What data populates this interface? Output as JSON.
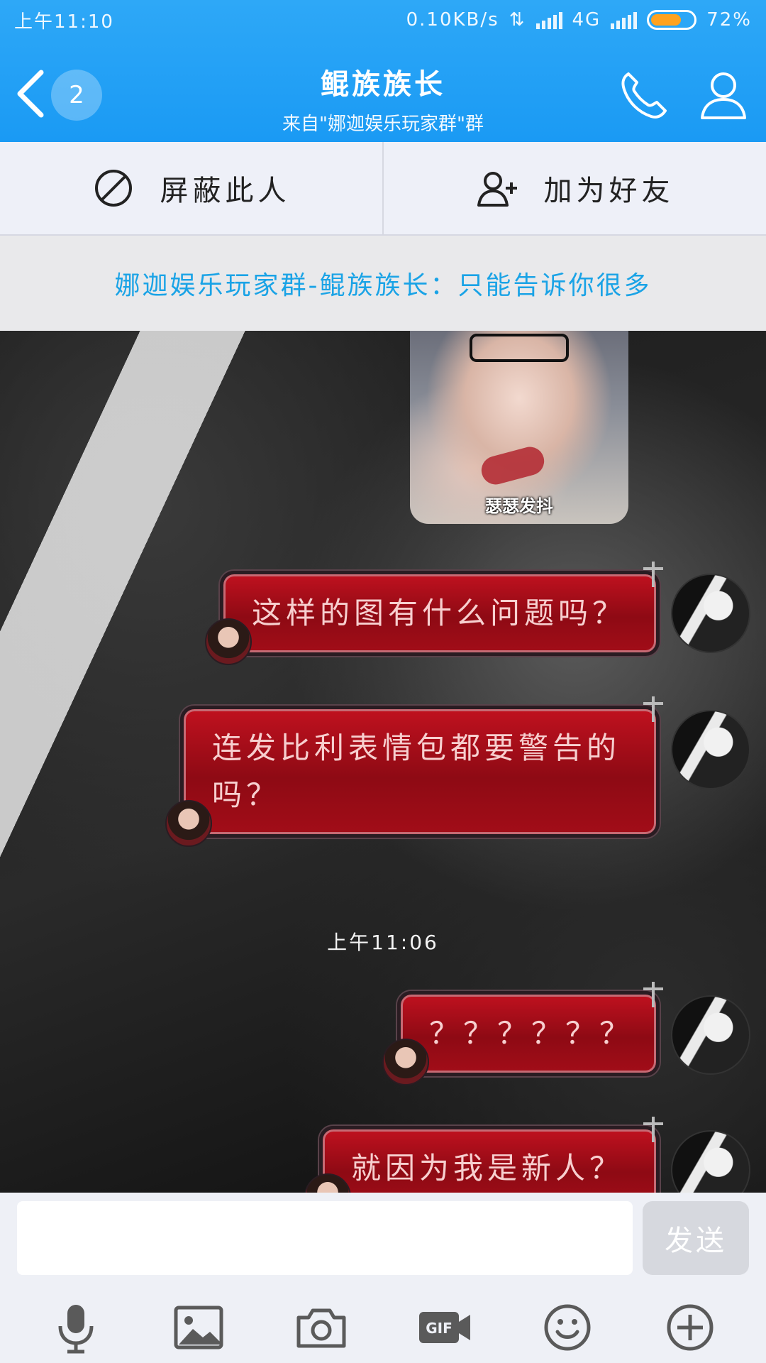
{
  "status_bar": {
    "time": "上午11:10",
    "network_speed": "0.10KB/s",
    "network_type": "4G",
    "battery": "72%",
    "battery_level": 0.72
  },
  "header": {
    "unread_count": "2",
    "title": "鲲族族长",
    "subtitle": "来自\"娜迦娱乐玩家群\"群"
  },
  "actions": {
    "block_label": "屏蔽此人",
    "add_friend_label": "加为好友"
  },
  "notice": "娜迦娱乐玩家群-鲲族族长：只能告诉你很多",
  "sticker": {
    "caption": "瑟瑟发抖"
  },
  "messages": [
    {
      "text": "这样的图有什么问题吗？"
    },
    {
      "text": "连发比利表情包都要警告的吗？"
    },
    {
      "text": "？？？？？？"
    },
    {
      "text": "就因为我是新人？"
    }
  ],
  "timestamp": "上午11:06",
  "input": {
    "value": "",
    "send_label": "发送"
  },
  "toolbar": [
    "microphone-icon",
    "image-icon",
    "camera-icon",
    "gif-icon",
    "emoji-icon",
    "plus-icon"
  ],
  "colors": {
    "header_blue": "#1a9af4",
    "notice_text": "#1aa3e6",
    "bubble_red": "#8e0a14",
    "battery_orange": "#ffa21f"
  }
}
